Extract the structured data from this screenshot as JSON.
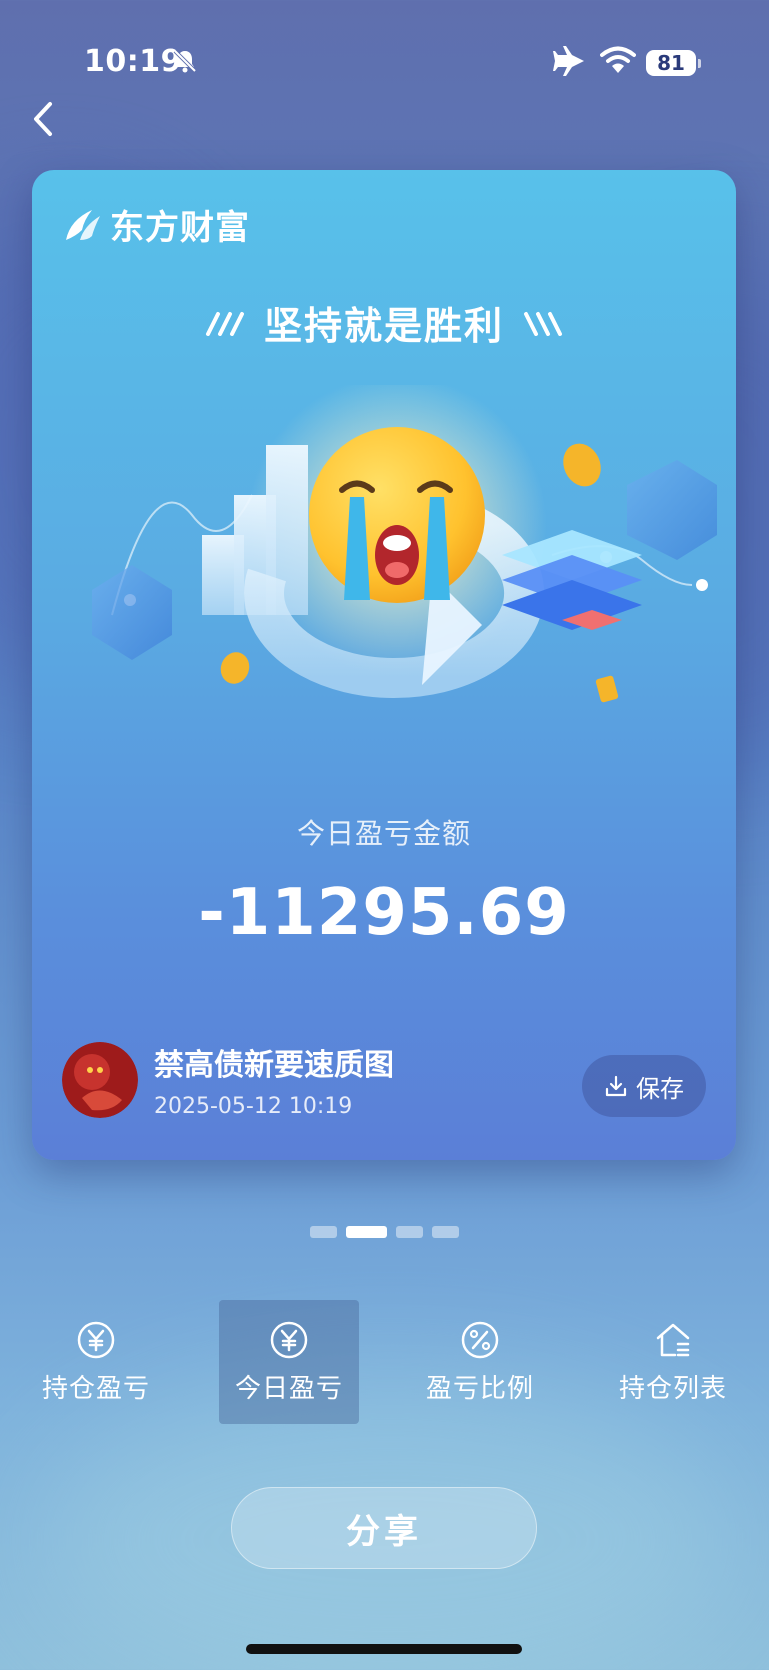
{
  "status_bar": {
    "time": "10:19",
    "battery": "81"
  },
  "card": {
    "brand": "东方财富",
    "headline": "坚持就是胜利",
    "label": "今日盈亏金额",
    "amount": "-11295.69",
    "user": {
      "name": "禁高债新要速质图",
      "timestamp": "2025-05-12 10:19"
    },
    "save_label": "保存"
  },
  "pager": {
    "count": 4,
    "active_index": 1
  },
  "tabs": [
    {
      "label": "持仓盈亏",
      "icon": "yen-circle-icon",
      "active": false
    },
    {
      "label": "今日盈亏",
      "icon": "yen-circle-icon",
      "active": true
    },
    {
      "label": "盈亏比例",
      "icon": "percent-circle-icon",
      "active": false
    },
    {
      "label": "持仓列表",
      "icon": "house-list-icon",
      "active": false
    }
  ],
  "share_label": "分享",
  "colors": {
    "card_top": "#58c1ea",
    "card_bottom": "#5b7fd7",
    "accent_coin": "#f5b52a"
  }
}
